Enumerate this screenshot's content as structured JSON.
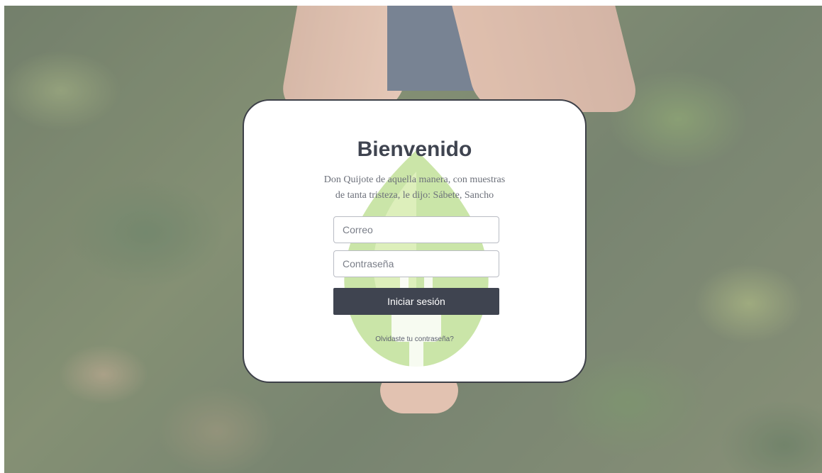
{
  "login": {
    "title": "Bienvenido",
    "subtitle_line1": "Don Quijote de aquella manera, con muestras",
    "subtitle_line2": "de tanta tristeza, le dijo: Sábete, Sancho",
    "email_placeholder": "Correo",
    "password_placeholder": "Contraseña",
    "submit_label": "Iniciar sesión",
    "forgot_link": "Olvidaste tu contraseña?"
  },
  "background": {
    "icon": "leaf-plug-logo-icon",
    "watermark_color": "#7fbf3f",
    "accent_color": "#3f4450"
  }
}
